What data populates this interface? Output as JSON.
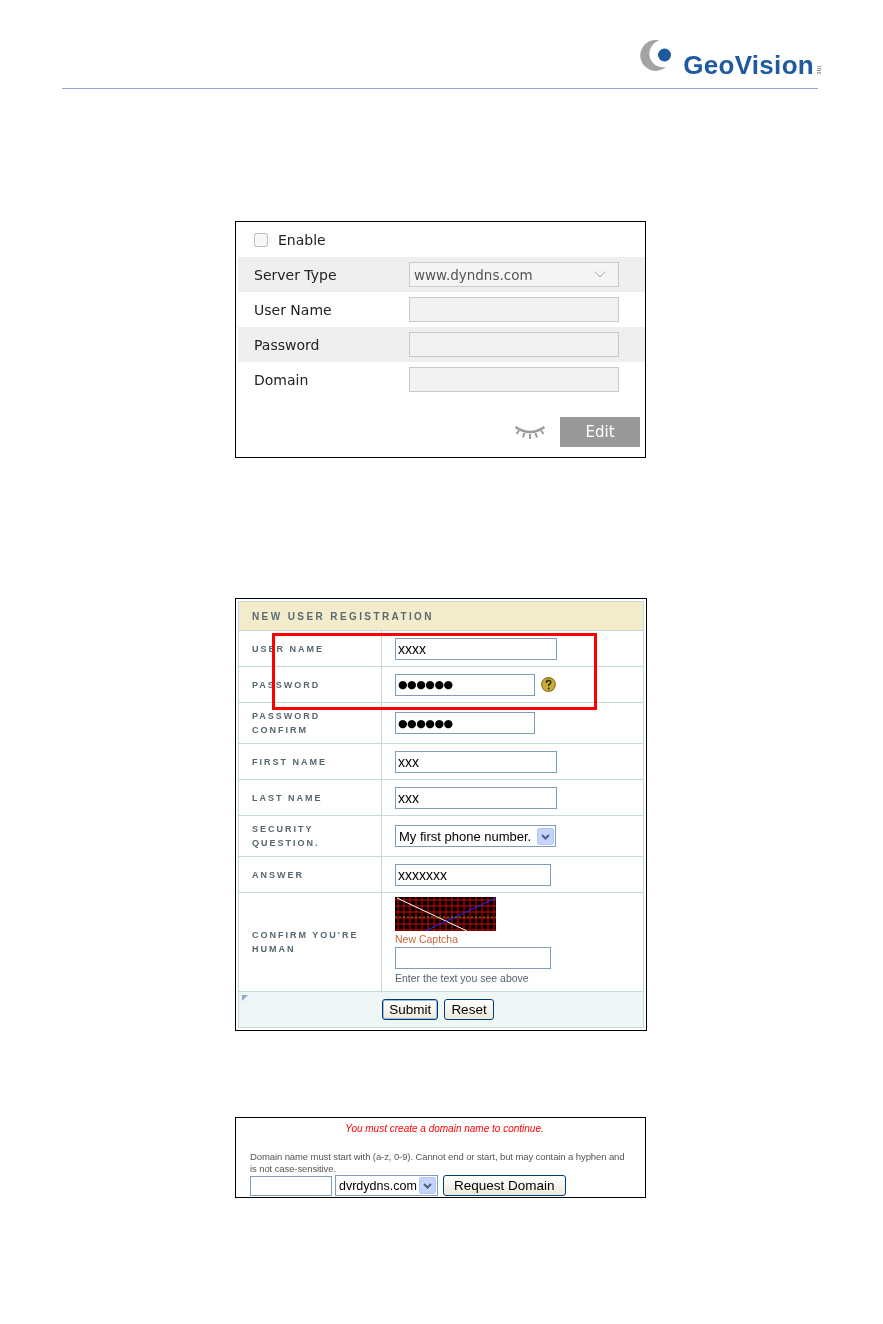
{
  "header": {
    "logo_name": "GeoVision",
    "logo_suffix": "inc"
  },
  "ddns_settings": {
    "enable": {
      "label": "Enable",
      "checked": false
    },
    "fields": [
      {
        "label": "Server Type",
        "kind": "select",
        "value": "www.dyndns.com"
      },
      {
        "label": "User Name",
        "kind": "input"
      },
      {
        "label": "Password",
        "kind": "input"
      },
      {
        "label": "Domain",
        "kind": "input"
      }
    ],
    "edit_button": "Edit"
  },
  "registration": {
    "title": "NEW USER REGISTRATION",
    "rows": [
      {
        "label": "USER NAME",
        "kind": "text",
        "value": "xxxx",
        "help": false
      },
      {
        "label": "PASSWORD",
        "kind": "password",
        "value": "●●●●●●",
        "help": true
      },
      {
        "label": "PASSWORD CONFIRM",
        "kind": "password",
        "value": "●●●●●●",
        "help": false
      },
      {
        "label": "FIRST NAME",
        "kind": "text",
        "value": "xxx",
        "help": false
      },
      {
        "label": "LAST NAME",
        "kind": "text",
        "value": "xxx",
        "help": false
      },
      {
        "label": "SECURITY QUESTION.",
        "kind": "select",
        "value": "My first phone number.",
        "help": false
      },
      {
        "label": "ANSWER",
        "kind": "text",
        "value": "xxxxxxx",
        "help": false
      },
      {
        "label": "CONFIRM YOU'RE HUMAN",
        "kind": "captcha",
        "link": "New Captcha",
        "hint": "Enter the text you see above",
        "help": false
      }
    ],
    "buttons": [
      "Submit",
      "Reset"
    ]
  },
  "domain_request": {
    "notice": "You must create a domain name to continue.",
    "rule": "Domain name must start with (a-z, 0-9). Cannot end or start, but may contain a hyphen and is not case-sensitive.",
    "suffix_select": "dvrdydns.com",
    "button": "Request Domain"
  }
}
